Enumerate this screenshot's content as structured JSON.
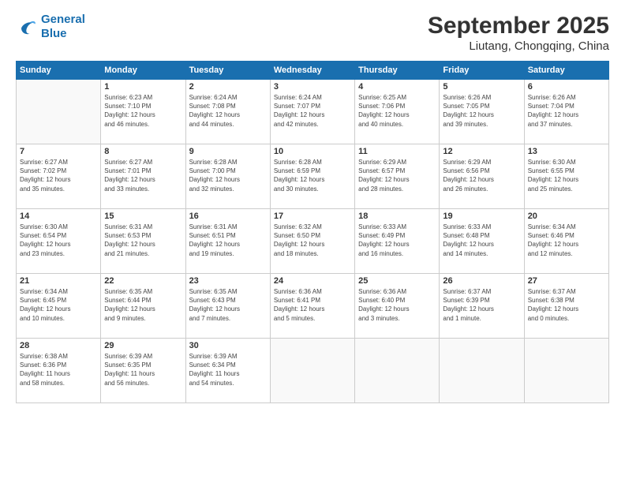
{
  "header": {
    "logo_line1": "General",
    "logo_line2": "Blue",
    "month": "September 2025",
    "location": "Liutang, Chongqing, China"
  },
  "weekdays": [
    "Sunday",
    "Monday",
    "Tuesday",
    "Wednesday",
    "Thursday",
    "Friday",
    "Saturday"
  ],
  "weeks": [
    [
      {
        "day": "",
        "info": ""
      },
      {
        "day": "1",
        "info": "Sunrise: 6:23 AM\nSunset: 7:10 PM\nDaylight: 12 hours\nand 46 minutes."
      },
      {
        "day": "2",
        "info": "Sunrise: 6:24 AM\nSunset: 7:08 PM\nDaylight: 12 hours\nand 44 minutes."
      },
      {
        "day": "3",
        "info": "Sunrise: 6:24 AM\nSunset: 7:07 PM\nDaylight: 12 hours\nand 42 minutes."
      },
      {
        "day": "4",
        "info": "Sunrise: 6:25 AM\nSunset: 7:06 PM\nDaylight: 12 hours\nand 40 minutes."
      },
      {
        "day": "5",
        "info": "Sunrise: 6:26 AM\nSunset: 7:05 PM\nDaylight: 12 hours\nand 39 minutes."
      },
      {
        "day": "6",
        "info": "Sunrise: 6:26 AM\nSunset: 7:04 PM\nDaylight: 12 hours\nand 37 minutes."
      }
    ],
    [
      {
        "day": "7",
        "info": "Sunrise: 6:27 AM\nSunset: 7:02 PM\nDaylight: 12 hours\nand 35 minutes."
      },
      {
        "day": "8",
        "info": "Sunrise: 6:27 AM\nSunset: 7:01 PM\nDaylight: 12 hours\nand 33 minutes."
      },
      {
        "day": "9",
        "info": "Sunrise: 6:28 AM\nSunset: 7:00 PM\nDaylight: 12 hours\nand 32 minutes."
      },
      {
        "day": "10",
        "info": "Sunrise: 6:28 AM\nSunset: 6:59 PM\nDaylight: 12 hours\nand 30 minutes."
      },
      {
        "day": "11",
        "info": "Sunrise: 6:29 AM\nSunset: 6:57 PM\nDaylight: 12 hours\nand 28 minutes."
      },
      {
        "day": "12",
        "info": "Sunrise: 6:29 AM\nSunset: 6:56 PM\nDaylight: 12 hours\nand 26 minutes."
      },
      {
        "day": "13",
        "info": "Sunrise: 6:30 AM\nSunset: 6:55 PM\nDaylight: 12 hours\nand 25 minutes."
      }
    ],
    [
      {
        "day": "14",
        "info": "Sunrise: 6:30 AM\nSunset: 6:54 PM\nDaylight: 12 hours\nand 23 minutes."
      },
      {
        "day": "15",
        "info": "Sunrise: 6:31 AM\nSunset: 6:53 PM\nDaylight: 12 hours\nand 21 minutes."
      },
      {
        "day": "16",
        "info": "Sunrise: 6:31 AM\nSunset: 6:51 PM\nDaylight: 12 hours\nand 19 minutes."
      },
      {
        "day": "17",
        "info": "Sunrise: 6:32 AM\nSunset: 6:50 PM\nDaylight: 12 hours\nand 18 minutes."
      },
      {
        "day": "18",
        "info": "Sunrise: 6:33 AM\nSunset: 6:49 PM\nDaylight: 12 hours\nand 16 minutes."
      },
      {
        "day": "19",
        "info": "Sunrise: 6:33 AM\nSunset: 6:48 PM\nDaylight: 12 hours\nand 14 minutes."
      },
      {
        "day": "20",
        "info": "Sunrise: 6:34 AM\nSunset: 6:46 PM\nDaylight: 12 hours\nand 12 minutes."
      }
    ],
    [
      {
        "day": "21",
        "info": "Sunrise: 6:34 AM\nSunset: 6:45 PM\nDaylight: 12 hours\nand 10 minutes."
      },
      {
        "day": "22",
        "info": "Sunrise: 6:35 AM\nSunset: 6:44 PM\nDaylight: 12 hours\nand 9 minutes."
      },
      {
        "day": "23",
        "info": "Sunrise: 6:35 AM\nSunset: 6:43 PM\nDaylight: 12 hours\nand 7 minutes."
      },
      {
        "day": "24",
        "info": "Sunrise: 6:36 AM\nSunset: 6:41 PM\nDaylight: 12 hours\nand 5 minutes."
      },
      {
        "day": "25",
        "info": "Sunrise: 6:36 AM\nSunset: 6:40 PM\nDaylight: 12 hours\nand 3 minutes."
      },
      {
        "day": "26",
        "info": "Sunrise: 6:37 AM\nSunset: 6:39 PM\nDaylight: 12 hours\nand 1 minute."
      },
      {
        "day": "27",
        "info": "Sunrise: 6:37 AM\nSunset: 6:38 PM\nDaylight: 12 hours\nand 0 minutes."
      }
    ],
    [
      {
        "day": "28",
        "info": "Sunrise: 6:38 AM\nSunset: 6:36 PM\nDaylight: 11 hours\nand 58 minutes."
      },
      {
        "day": "29",
        "info": "Sunrise: 6:39 AM\nSunset: 6:35 PM\nDaylight: 11 hours\nand 56 minutes."
      },
      {
        "day": "30",
        "info": "Sunrise: 6:39 AM\nSunset: 6:34 PM\nDaylight: 11 hours\nand 54 minutes."
      },
      {
        "day": "",
        "info": ""
      },
      {
        "day": "",
        "info": ""
      },
      {
        "day": "",
        "info": ""
      },
      {
        "day": "",
        "info": ""
      }
    ]
  ]
}
